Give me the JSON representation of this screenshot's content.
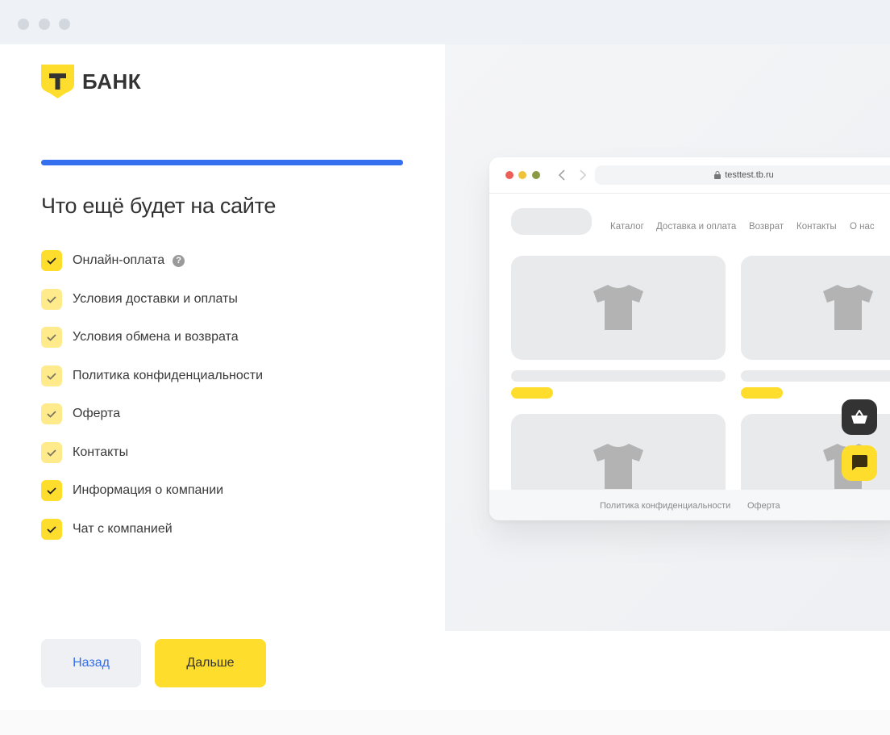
{
  "brand": {
    "name": "БАНК",
    "letter": "Т"
  },
  "progress": {
    "value": 1.0
  },
  "title": "Что ещё будет на сайте",
  "options": [
    {
      "label": "Онлайн-оплата",
      "checked": true,
      "locked": false,
      "help": true
    },
    {
      "label": "Условия доставки и оплаты",
      "checked": true,
      "locked": true
    },
    {
      "label": "Условия обмена и возврата",
      "checked": true,
      "locked": true
    },
    {
      "label": "Политика конфиденциальности",
      "checked": true,
      "locked": true
    },
    {
      "label": "Оферта",
      "checked": true,
      "locked": true
    },
    {
      "label": "Контакты",
      "checked": true,
      "locked": true
    },
    {
      "label": "Информация о компании",
      "checked": true,
      "locked": false
    },
    {
      "label": "Чат с компанией",
      "checked": true,
      "locked": false
    }
  ],
  "help_icon": "?",
  "buttons": {
    "back": "Назад",
    "next": "Дальше"
  },
  "preview": {
    "url": "testtest.tb.ru",
    "nav": [
      "Каталог",
      "Доставка и оплата",
      "Возврат",
      "Контакты",
      "О нас"
    ],
    "footer": [
      "Политика конфиденциальности",
      "Оферта"
    ]
  },
  "colors": {
    "accent": "#ffdd2d",
    "progress": "#336fee",
    "link": "#336fee"
  }
}
